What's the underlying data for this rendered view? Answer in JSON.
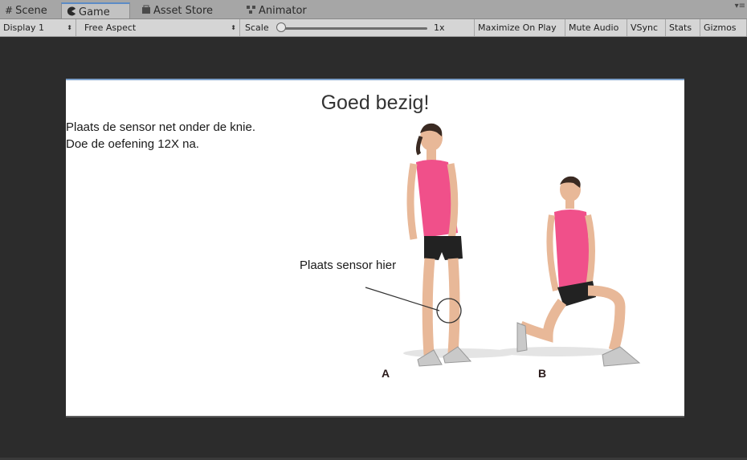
{
  "tabs": [
    {
      "label": "Scene",
      "icon": "grid-icon"
    },
    {
      "label": "Game",
      "icon": "pacman-icon"
    },
    {
      "label": "Asset Store",
      "icon": "store-icon"
    },
    {
      "label": "Animator",
      "icon": "animator-icon"
    }
  ],
  "toolbar": {
    "display": "Display 1",
    "aspect": "Free Aspect",
    "scale_label": "Scale",
    "scale_value": "1x",
    "maximize": "Maximize On Play",
    "mute": "Mute Audio",
    "vsync": "VSync",
    "stats": "Stats",
    "gizmos": "Gizmos"
  },
  "game": {
    "title": "Goed bezig!",
    "instruction_line1": "Plaats de sensor net onder de knie.",
    "instruction_line2": "Doe de oefening 12X na.",
    "sensor_label": "Plaats sensor hier",
    "figure_a": "A",
    "figure_b": "B"
  },
  "colors": {
    "shirt": "#f0508a",
    "accent_tab": "#5c8bc6",
    "background": "#2b2b2b"
  }
}
